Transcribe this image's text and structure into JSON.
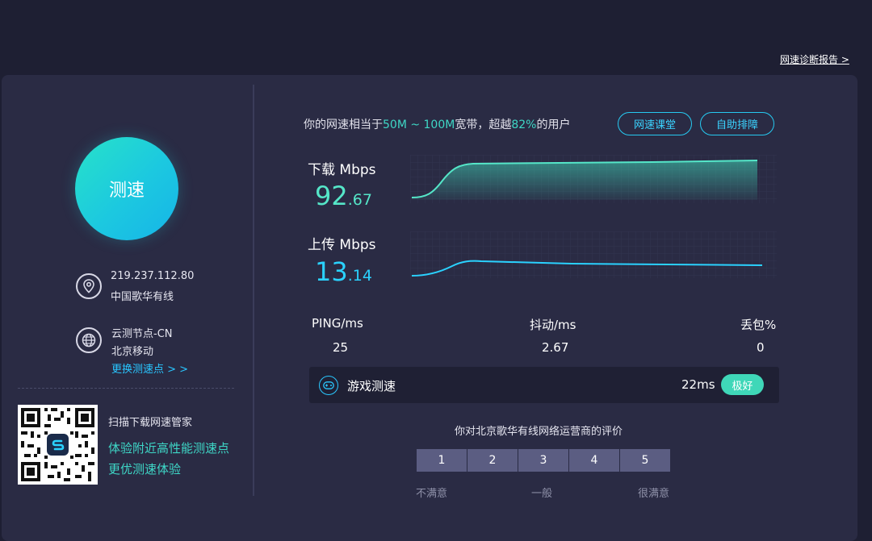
{
  "header": {
    "report_link": "网速诊断报告 >"
  },
  "left": {
    "speed_button": "测速",
    "ip": "219.237.112.80",
    "isp": "中国歌华有线",
    "node": "云测节点-CN",
    "node_isp": "北京移动",
    "change_node": "更换测速点 > >",
    "promo": {
      "title": "扫描下载网速管家",
      "line1": "体验附近高性能测速点",
      "line2": "更优测速体验"
    }
  },
  "summary": {
    "prefix": "你的网速相当于",
    "bandwidth": "50M ~ 100M",
    "middle": "宽带，超越",
    "percent": "82%",
    "suffix": "的用户"
  },
  "buttons": {
    "course": "网速课堂",
    "self_help": "自助排障"
  },
  "download": {
    "label": "下载 Mbps",
    "int": "92",
    "dec": ".67"
  },
  "upload": {
    "label": "上传 Mbps",
    "int": "13",
    "dec": ".14"
  },
  "stats": {
    "ping_label": "PING/ms",
    "ping_value": "25",
    "jitter_label": "抖动/ms",
    "jitter_value": "2.67",
    "loss_label": "丢包%",
    "loss_value": "0"
  },
  "game": {
    "label": "游戏测速",
    "ms": "22ms",
    "badge": "极好"
  },
  "rating": {
    "question": "你对北京歌华有线网络运营商的评价",
    "options": [
      "1",
      "2",
      "3",
      "4",
      "5"
    ],
    "low": "不满意",
    "mid": "一般",
    "high": "很满意"
  },
  "colors": {
    "download_accent": "#55e6c8",
    "upload_accent": "#2ad2ff",
    "button_border": "#26c9f0",
    "badge": "#3fd7b8"
  },
  "icons": {
    "location": "location-pin-icon",
    "globe": "globe-icon",
    "game": "gamepad-icon",
    "qr": "qr-code-icon"
  }
}
